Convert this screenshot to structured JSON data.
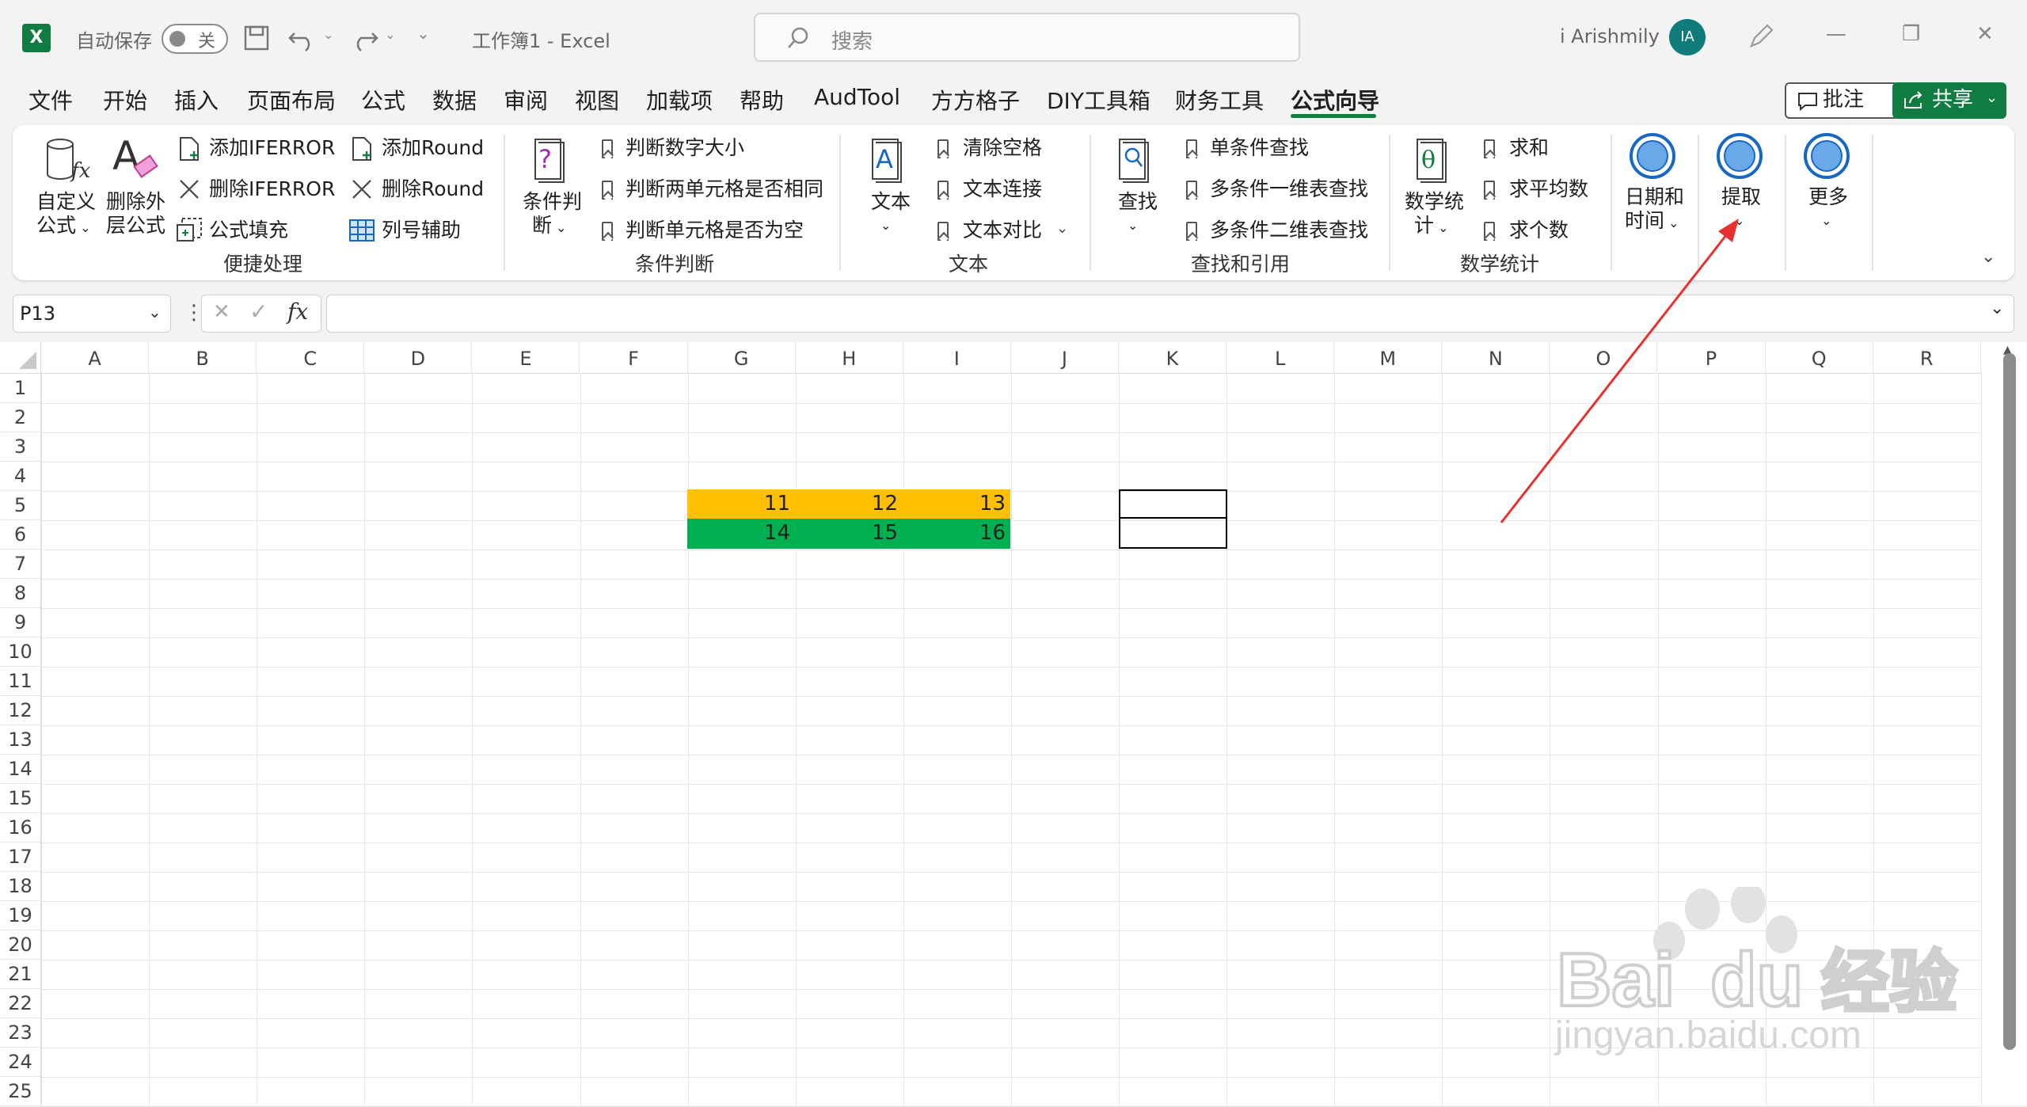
{
  "titlebar": {
    "autosave_label": "自动保存",
    "autosave_state": "关",
    "doc_title": "工作簿1  -  Excel",
    "search_placeholder": "搜索",
    "user_name": "i Arishmily",
    "avatar_initials": "IA"
  },
  "tabs": [
    "文件",
    "开始",
    "插入",
    "页面布局",
    "公式",
    "数据",
    "审阅",
    "视图",
    "加载项",
    "帮助",
    "AudTool",
    "方方格子",
    "DIY工具箱",
    "财务工具",
    "公式向导"
  ],
  "active_tab": "公式向导",
  "actions": {
    "comment": "批注",
    "share": "共享"
  },
  "ribbon": {
    "convenience": {
      "custom_formula": [
        "自定义",
        "公式"
      ],
      "remove_outer": [
        "删除外",
        "层公式"
      ],
      "add_iferror": "添加IFERROR",
      "del_iferror": "删除IFERROR",
      "fill_formula": "公式填充",
      "add_round": "添加Round",
      "del_round": "删除Round",
      "col_helper": "列号辅助",
      "label": "便捷处理"
    },
    "condition": {
      "big": [
        "条件判",
        "断"
      ],
      "items": [
        "判断数字大小",
        "判断两单元格是否相同",
        "判断单元格是否为空"
      ],
      "label": "条件判断"
    },
    "text": {
      "big": "文本",
      "items": [
        "清除空格",
        "文本连接",
        "文本对比"
      ],
      "label": "文本"
    },
    "lookup": {
      "big": "查找",
      "items": [
        "单条件查找",
        "多条件一维表查找",
        "多条件二维表查找"
      ],
      "label": "查找和引用"
    },
    "math": {
      "big": [
        "数学统",
        "计"
      ],
      "items": [
        "求和",
        "求平均数",
        "求个数"
      ],
      "label": "数学统计"
    },
    "datetime": [
      "日期和",
      "时间"
    ],
    "extract": "提取",
    "more": "更多"
  },
  "formula_bar": {
    "name_box": "P13",
    "fx": "fx",
    "formula": ""
  },
  "columns": [
    "A",
    "B",
    "C",
    "D",
    "E",
    "F",
    "G",
    "H",
    "I",
    "J",
    "K",
    "L",
    "M",
    "N",
    "O",
    "P",
    "Q",
    "R"
  ],
  "rows": [
    "1",
    "2",
    "3",
    "4",
    "5",
    "6",
    "7",
    "8",
    "9",
    "10",
    "11",
    "12",
    "13",
    "14",
    "15",
    "16",
    "17",
    "18",
    "19",
    "20",
    "21",
    "22",
    "23",
    "24",
    "25"
  ],
  "cells": {
    "G5": "11",
    "H5": "12",
    "I5": "13",
    "G6": "14",
    "H6": "15",
    "I6": "16"
  },
  "colors": {
    "accent": "#107c41",
    "row5_fill": "#ffc000",
    "row6_fill": "#00b050",
    "arrow": "#e8302e"
  },
  "watermark": {
    "brand": "Bai du 经验",
    "url": "jingyan.baidu.com"
  }
}
